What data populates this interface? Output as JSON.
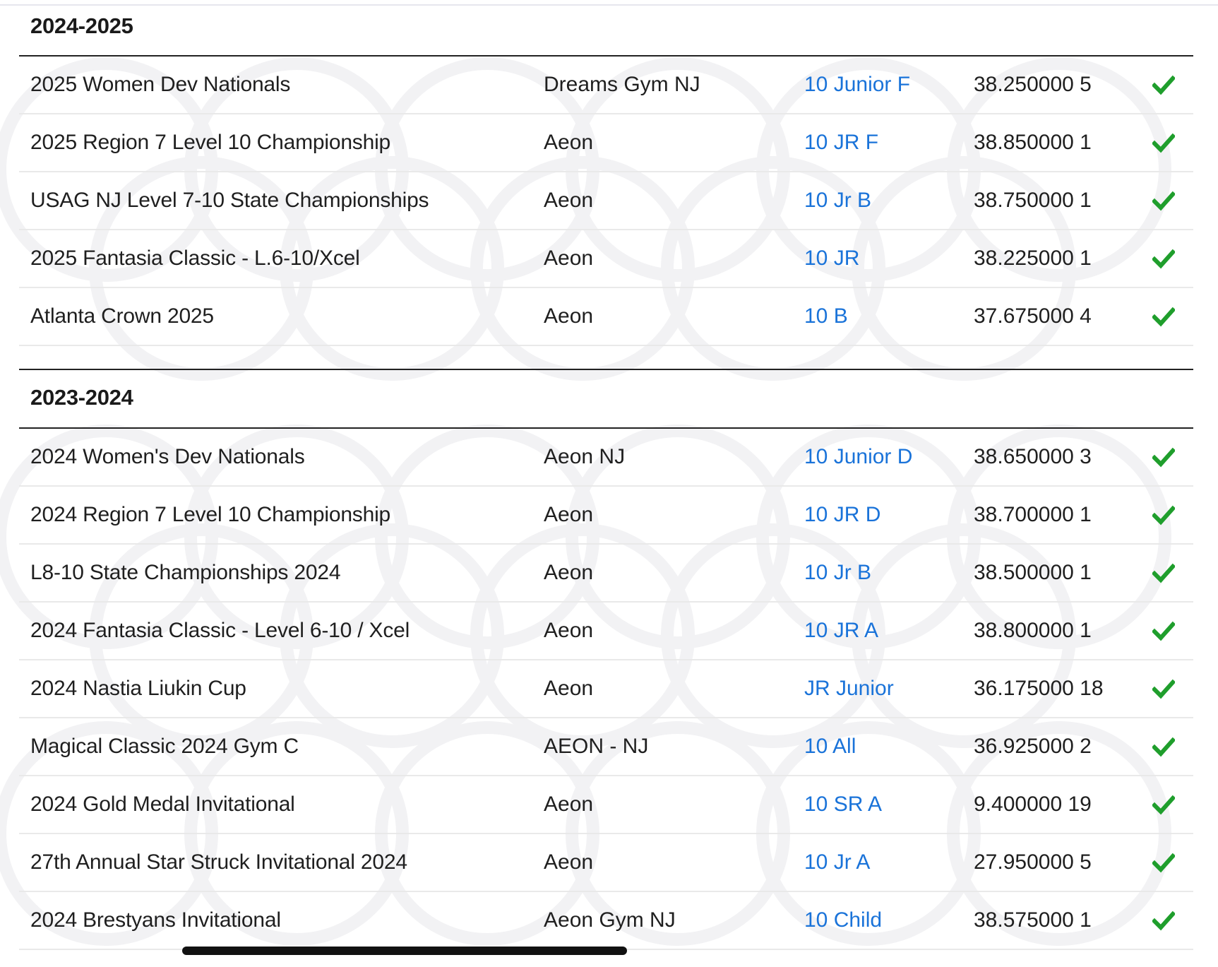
{
  "seasons": [
    {
      "label": "2024-2025",
      "meets": [
        {
          "meet": "2025 Women Dev Nationals",
          "gym": "Dreams Gym NJ",
          "level": "10 Junior F",
          "score": "38.250000 5"
        },
        {
          "meet": "2025 Region 7 Level 10 Championship",
          "gym": "Aeon",
          "level": "10 JR F",
          "score": "38.850000 1"
        },
        {
          "meet": "USAG NJ Level 7-10 State Championships",
          "gym": "Aeon",
          "level": "10 Jr B",
          "score": "38.750000 1"
        },
        {
          "meet": "2025 Fantasia Classic - L.6-10/Xcel",
          "gym": "Aeon",
          "level": "10 JR",
          "score": "38.225000 1"
        },
        {
          "meet": "Atlanta Crown 2025",
          "gym": "Aeon",
          "level": "10 B",
          "score": "37.675000 4"
        }
      ]
    },
    {
      "label": "2023-2024",
      "meets": [
        {
          "meet": "2024 Women's Dev Nationals",
          "gym": "Aeon NJ",
          "level": "10 Junior D",
          "score": "38.650000 3"
        },
        {
          "meet": "2024 Region 7 Level 10 Championship",
          "gym": "Aeon",
          "level": "10 JR D",
          "score": "38.700000 1"
        },
        {
          "meet": "L8-10 State Championships 2024",
          "gym": "Aeon",
          "level": "10 Jr B",
          "score": "38.500000 1"
        },
        {
          "meet": "2024 Fantasia Classic - Level 6-10 / Xcel",
          "gym": "Aeon",
          "level": "10 JR A",
          "score": "38.800000 1"
        },
        {
          "meet": "2024 Nastia Liukin Cup",
          "gym": "Aeon",
          "level": "JR Junior",
          "score": "36.175000 18"
        },
        {
          "meet": "Magical Classic 2024 Gym C",
          "gym": "AEON - NJ",
          "level": "10 All",
          "score": "36.925000 2"
        },
        {
          "meet": "2024 Gold Medal Invitational",
          "gym": "Aeon",
          "level": "10 SR A",
          "score": "9.400000 19"
        },
        {
          "meet": "27th Annual Star Struck Invitational 2024",
          "gym": "Aeon",
          "level": "10 Jr A",
          "score": "27.950000 5"
        },
        {
          "meet": "2024 Brestyans Invitational",
          "gym": "Aeon Gym NJ",
          "level": "10 Child",
          "score": "38.575000 1"
        }
      ]
    }
  ],
  "icons": {
    "row_status": "checkmark-icon"
  },
  "colors": {
    "level_link": "#1a73d9",
    "check": "#1f9e2c",
    "divider_strong": "#222222",
    "divider_light": "#e9e9e9"
  }
}
